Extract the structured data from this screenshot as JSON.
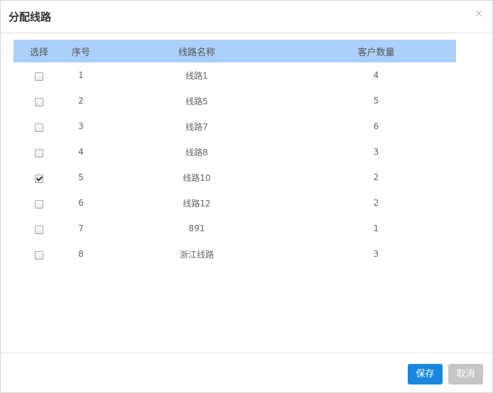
{
  "dialog": {
    "title": "分配线路",
    "close_symbol": "×"
  },
  "table": {
    "headers": {
      "select": "选择",
      "index": "序号",
      "name": "线路名称",
      "count": "客户数量"
    },
    "rows": [
      {
        "index": "1",
        "name": "线路1",
        "count": "4",
        "checked": false
      },
      {
        "index": "2",
        "name": "线路5",
        "count": "5",
        "checked": false
      },
      {
        "index": "3",
        "name": "线路7",
        "count": "6",
        "checked": false
      },
      {
        "index": "4",
        "name": "线路8",
        "count": "3",
        "checked": false
      },
      {
        "index": "5",
        "name": "线路10",
        "count": "2",
        "checked": true
      },
      {
        "index": "6",
        "name": "线路12",
        "count": "2",
        "checked": false
      },
      {
        "index": "7",
        "name": "891",
        "count": "1",
        "checked": false
      },
      {
        "index": "8",
        "name": "浙江线路",
        "count": "3",
        "checked": false
      }
    ]
  },
  "footer": {
    "save_label": "保存",
    "cancel_label": "取消"
  },
  "colors": {
    "header_bg": "#aad1f9",
    "save_bg": "#1a86dd",
    "cancel_bg": "#c6c6c6"
  },
  "icons": {
    "close": "close-icon",
    "checkbox": "checkbox"
  }
}
